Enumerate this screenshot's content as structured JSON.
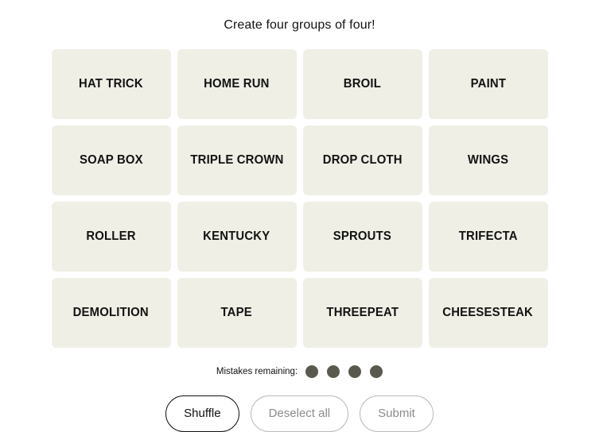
{
  "header": {
    "instruction": "Create four groups of four!"
  },
  "grid": {
    "rows": [
      [
        "HAT TRICK",
        "HOME RUN",
        "BROIL",
        "PAINT"
      ],
      [
        "SOAP BOX",
        "TRIPLE CROWN",
        "DROP CLOTH",
        "WINGS"
      ],
      [
        "ROLLER",
        "KENTUCKY",
        "SPROUTS",
        "TRIFECTA"
      ],
      [
        "DEMOLITION",
        "TAPE",
        "THREEPEAT",
        "CHEESESTEAK"
      ]
    ]
  },
  "mistakes": {
    "label": "Mistakes remaining:",
    "remaining": 4,
    "dot_color": "#5a594e"
  },
  "controls": {
    "shuffle_label": "Shuffle",
    "deselect_label": "Deselect all",
    "submit_label": "Submit"
  },
  "colors": {
    "page_background": "#ffffff",
    "tile_background": "#efefe6",
    "text": "#121212",
    "disabled_text": "#8c8c8c",
    "disabled_border": "#b9b9b9"
  }
}
